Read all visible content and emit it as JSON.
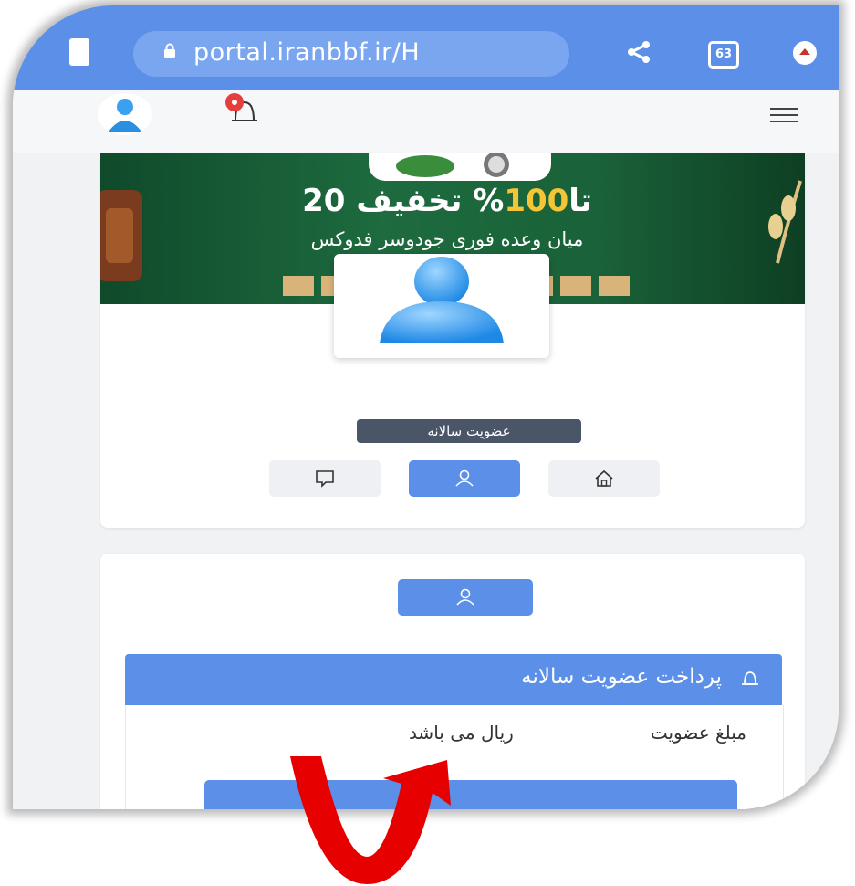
{
  "browser": {
    "url": "portal.iranbbf.ir/H",
    "tab_count": "63"
  },
  "header": {
    "notification_count": ""
  },
  "banner": {
    "discount_prefix": "20 تا",
    "discount_number": "100",
    "discount_suffix": "% تخفیف",
    "subtitle": "میان وعده فوری جودوسر فدوکس"
  },
  "profile": {
    "membership_badge": "عضویت سالانه"
  },
  "panel": {
    "title": "پرداخت عضویت سالانه",
    "amount_prefix": "مبلغ عضویت",
    "amount_suffix": "ریال می باشد"
  },
  "colors": {
    "primary": "#5b8fe8",
    "badge": "#4a5568",
    "arrow": "#e60000"
  }
}
